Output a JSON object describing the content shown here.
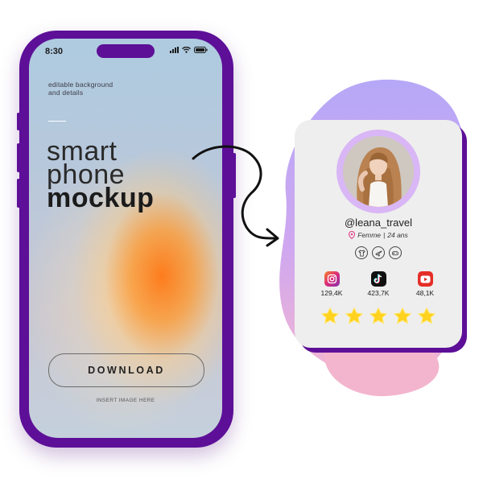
{
  "phone": {
    "status_time": "30",
    "tagline_line1": "editable background",
    "tagline_line2": "and details",
    "title_line1": "smart",
    "title_line2": "phone",
    "title_line3": "mockup",
    "download_label": "DOWNLOAD",
    "insert_image_text": "INSERT IMAGE  HERE"
  },
  "profile_card": {
    "username": "@leana_travel",
    "gender": "Femme",
    "age": "24 ans",
    "interests": [
      "shirt-icon",
      "airplane-icon",
      "gamepad-icon"
    ],
    "socials": [
      {
        "icon": "instagram-icon",
        "count": "129,4K",
        "color": "#d63a5f"
      },
      {
        "icon": "tiktok-icon",
        "count": "423,7K",
        "color": "#111111"
      },
      {
        "icon": "youtube-icon",
        "count": "48,1K",
        "color": "#e52d27"
      }
    ],
    "rating": 5,
    "rating_max": 5
  },
  "colors": {
    "accent": "#5d0f97",
    "star": "#ffd21f",
    "blob_purple": "#b9a7f5",
    "blob_pink": "#f5b8cf"
  }
}
